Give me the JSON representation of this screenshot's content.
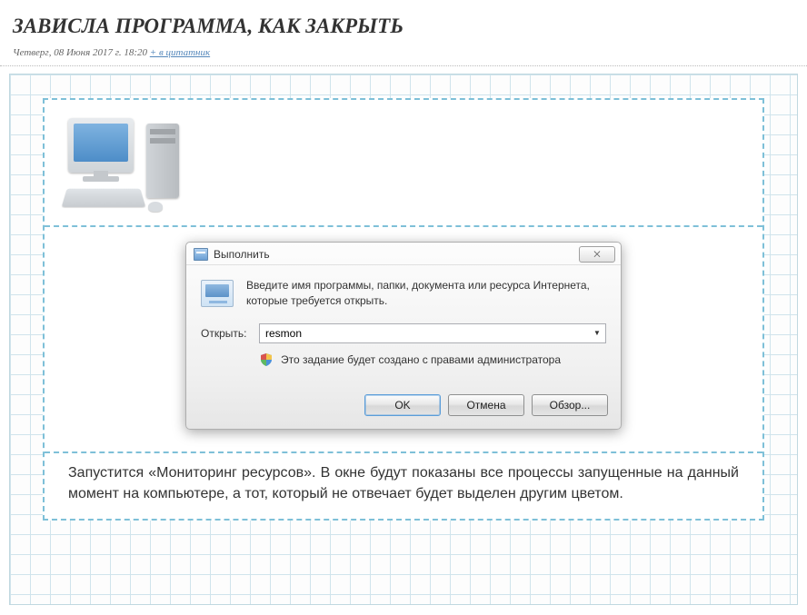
{
  "article": {
    "title": "ЗАВИСЛА ПРОГРАММА, КАК ЗАКРЫТЬ",
    "meta_date": "Четверг, 08 Июня 2017 г. 18:20",
    "meta_link": "+ в цитатник",
    "body_paragraph": "Запустится «Мониторинг ресурсов». В окне будут показаны все процессы запущенные на данный момент на компьютере, а тот, который не отвечает будет выделен другим цветом."
  },
  "run_dialog": {
    "title": "Выполнить",
    "close_glyph": "✕",
    "description": "Введите имя программы, папки, документа или ресурса Интернета, которые требуется открыть.",
    "open_label": "Открыть:",
    "command_value": "resmon",
    "dropdown_arrow": "▼",
    "admin_note": "Это задание будет создано с правами администратора",
    "ok_label": "OK",
    "cancel_label": "Отмена",
    "browse_label": "Обзор..."
  }
}
